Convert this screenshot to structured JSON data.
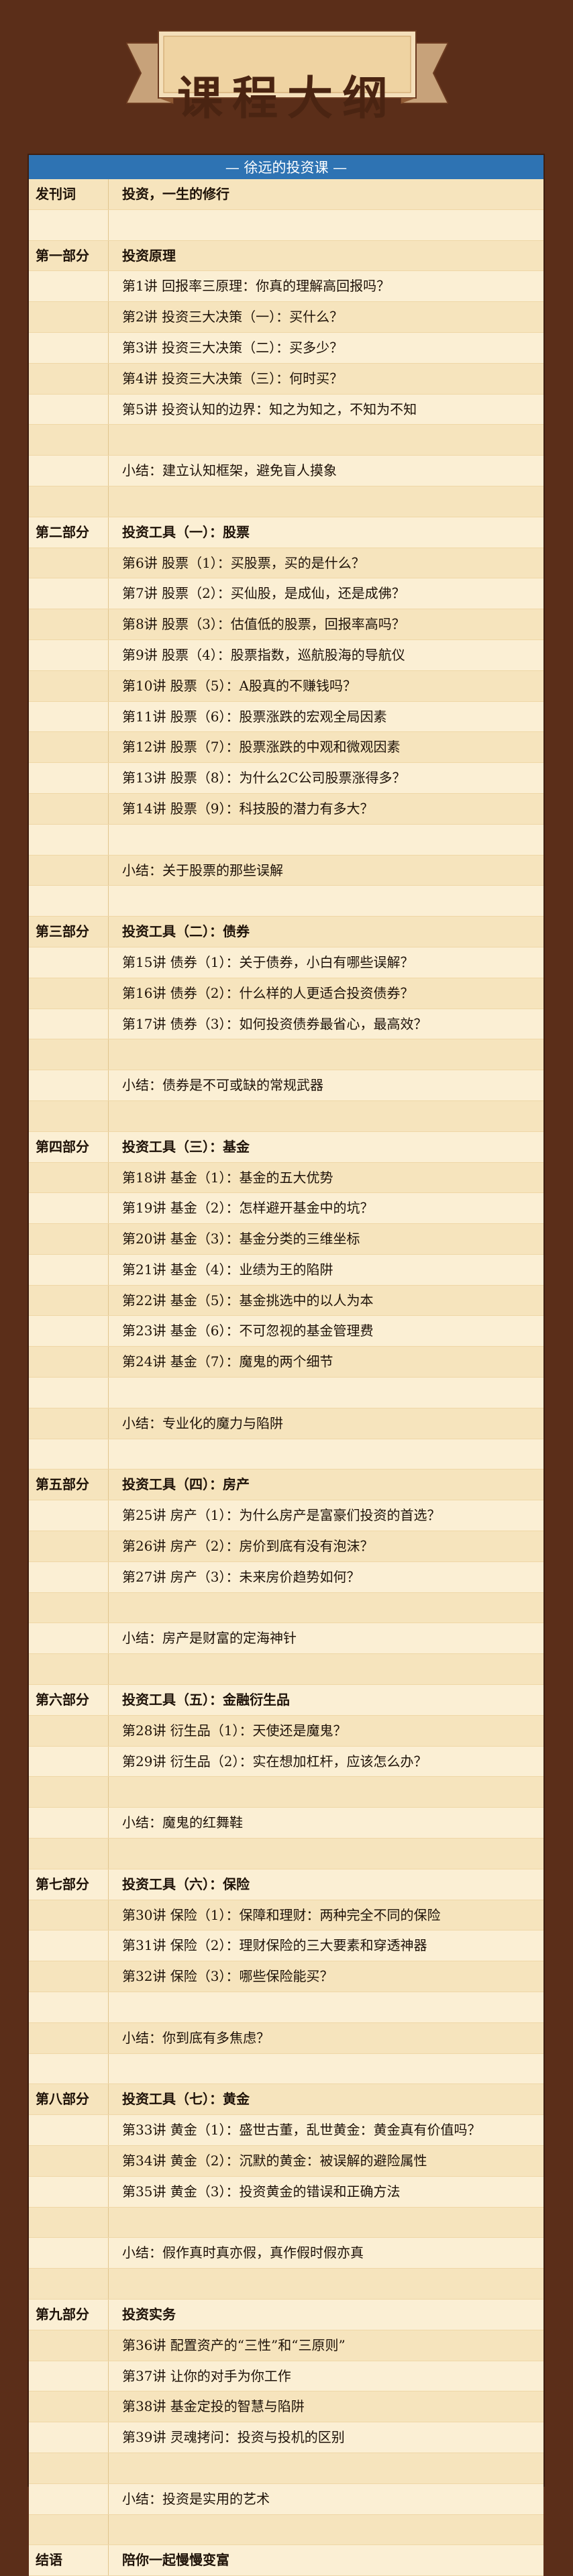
{
  "page_title": "课程大纲",
  "course_name": "— 徐远的投资课 —",
  "rows": [
    {
      "section": "发刊词",
      "text": "投资，一生的修行",
      "bold": true
    },
    {
      "section": "",
      "text": "",
      "bold": false
    },
    {
      "section": "第一部分",
      "text": "投资原理",
      "bold": true
    },
    {
      "section": "",
      "text": "第1讲  回报率三原理：你真的理解高回报吗？",
      "bold": false
    },
    {
      "section": "",
      "text": "第2讲  投资三大决策（一）：买什么？",
      "bold": false
    },
    {
      "section": "",
      "text": "第3讲  投资三大决策（二）：买多少？",
      "bold": false
    },
    {
      "section": "",
      "text": "第4讲  投资三大决策（三）：何时买？",
      "bold": false
    },
    {
      "section": "",
      "text": "第5讲  投资认知的边界：知之为知之，不知为不知",
      "bold": false
    },
    {
      "section": "",
      "text": "",
      "bold": false
    },
    {
      "section": "",
      "text": "小结：建立认知框架，避免盲人摸象",
      "bold": false
    },
    {
      "section": "",
      "text": "",
      "bold": false
    },
    {
      "section": "第二部分",
      "text": "投资工具（一）：股票",
      "bold": true
    },
    {
      "section": "",
      "text": "第6讲  股票（1）：买股票，买的是什么？",
      "bold": false
    },
    {
      "section": "",
      "text": "第7讲  股票（2）：买仙股，是成仙，还是成佛？",
      "bold": false
    },
    {
      "section": "",
      "text": "第8讲  股票（3）：估值低的股票，回报率高吗？",
      "bold": false
    },
    {
      "section": "",
      "text": "第9讲  股票（4）：股票指数，巡航股海的导航仪",
      "bold": false
    },
    {
      "section": "",
      "text": "第10讲 股票（5）：A股真的不赚钱吗？",
      "bold": false
    },
    {
      "section": "",
      "text": "第11讲 股票（6）：股票涨跌的宏观全局因素",
      "bold": false
    },
    {
      "section": "",
      "text": "第12讲 股票（7）：股票涨跌的中观和微观因素",
      "bold": false
    },
    {
      "section": "",
      "text": "第13讲 股票（8）：为什么2C公司股票涨得多？",
      "bold": false
    },
    {
      "section": "",
      "text": "第14讲 股票（9）：科技股的潜力有多大？",
      "bold": false
    },
    {
      "section": "",
      "text": "",
      "bold": false
    },
    {
      "section": "",
      "text": "小结：关于股票的那些误解",
      "bold": false
    },
    {
      "section": "",
      "text": "",
      "bold": false
    },
    {
      "section": "第三部分",
      "text": "投资工具（二）：债券",
      "bold": true
    },
    {
      "section": "",
      "text": "第15讲 债券（1）：关于债券，小白有哪些误解？",
      "bold": false
    },
    {
      "section": "",
      "text": "第16讲 债券（2）：什么样的人更适合投资债券？",
      "bold": false
    },
    {
      "section": "",
      "text": "第17讲 债券（3）：如何投资债券最省心，最高效？",
      "bold": false
    },
    {
      "section": "",
      "text": "",
      "bold": false
    },
    {
      "section": "",
      "text": "小结：债券是不可或缺的常规武器",
      "bold": false
    },
    {
      "section": "",
      "text": "",
      "bold": false
    },
    {
      "section": "第四部分",
      "text": "投资工具（三）：基金",
      "bold": true
    },
    {
      "section": "",
      "text": "第18讲 基金（1）：基金的五大优势",
      "bold": false
    },
    {
      "section": "",
      "text": "第19讲 基金（2）：怎样避开基金中的坑？",
      "bold": false
    },
    {
      "section": "",
      "text": "第20讲 基金（3）：基金分类的三维坐标",
      "bold": false
    },
    {
      "section": "",
      "text": "第21讲 基金（4）：业绩为王的陷阱",
      "bold": false
    },
    {
      "section": "",
      "text": "第22讲 基金（5）：基金挑选中的以人为本",
      "bold": false
    },
    {
      "section": "",
      "text": "第23讲 基金（6）：不可忽视的基金管理费",
      "bold": false
    },
    {
      "section": "",
      "text": "第24讲 基金（7）：魔鬼的两个细节",
      "bold": false
    },
    {
      "section": "",
      "text": "",
      "bold": false
    },
    {
      "section": "",
      "text": "小结：专业化的魔力与陷阱",
      "bold": false
    },
    {
      "section": "",
      "text": "",
      "bold": false
    },
    {
      "section": "第五部分",
      "text": "投资工具（四）：房产",
      "bold": true
    },
    {
      "section": "",
      "text": "第25讲 房产（1）：为什么房产是富豪们投资的首选？",
      "bold": false
    },
    {
      "section": "",
      "text": "第26讲 房产（2）：房价到底有没有泡沫？",
      "bold": false
    },
    {
      "section": "",
      "text": "第27讲 房产（3）：未来房价趋势如何？",
      "bold": false
    },
    {
      "section": "",
      "text": "",
      "bold": false
    },
    {
      "section": "",
      "text": "小结：房产是财富的定海神针",
      "bold": false
    },
    {
      "section": "",
      "text": "",
      "bold": false
    },
    {
      "section": "第六部分",
      "text": "投资工具（五）：金融衍生品",
      "bold": true
    },
    {
      "section": "",
      "text": "第28讲 衍生品（1）：天使还是魔鬼？",
      "bold": false
    },
    {
      "section": "",
      "text": "第29讲 衍生品（2）：实在想加杠杆，应该怎么办？",
      "bold": false
    },
    {
      "section": "",
      "text": "",
      "bold": false
    },
    {
      "section": "",
      "text": "小结：魔鬼的红舞鞋",
      "bold": false
    },
    {
      "section": "",
      "text": "",
      "bold": false
    },
    {
      "section": "第七部分",
      "text": "投资工具（六）：保险",
      "bold": true
    },
    {
      "section": "",
      "text": "第30讲 保险（1）：保障和理财：两种完全不同的保险",
      "bold": false
    },
    {
      "section": "",
      "text": "第31讲 保险（2）：理财保险的三大要素和穿透神器",
      "bold": false
    },
    {
      "section": "",
      "text": "第32讲 保险（3）：哪些保险能买？",
      "bold": false
    },
    {
      "section": "",
      "text": "",
      "bold": false
    },
    {
      "section": "",
      "text": "小结：你到底有多焦虑？",
      "bold": false
    },
    {
      "section": "",
      "text": "",
      "bold": false
    },
    {
      "section": "第八部分",
      "text": "投资工具（七）：黄金",
      "bold": true
    },
    {
      "section": "",
      "text": "第33讲 黄金（1）：盛世古董，乱世黄金：黄金真有价值吗？",
      "bold": false
    },
    {
      "section": "",
      "text": "第34讲 黄金（2）：沉默的黄金：被误解的避险属性",
      "bold": false
    },
    {
      "section": "",
      "text": "第35讲 黄金（3）：投资黄金的错误和正确方法",
      "bold": false
    },
    {
      "section": "",
      "text": "",
      "bold": false
    },
    {
      "section": "",
      "text": "小结：假作真时真亦假，真作假时假亦真",
      "bold": false
    },
    {
      "section": "",
      "text": "",
      "bold": false
    },
    {
      "section": "第九部分",
      "text": "投资实务",
      "bold": true
    },
    {
      "section": "",
      "text": "第36讲 配置资产的“三性”和“三原则”",
      "bold": false
    },
    {
      "section": "",
      "text": "第37讲 让你的对手为你工作",
      "bold": false
    },
    {
      "section": "",
      "text": "第38讲 基金定投的智慧与陷阱",
      "bold": false
    },
    {
      "section": "",
      "text": "第39讲 灵魂拷问：投资与投机的区别",
      "bold": false
    },
    {
      "section": "",
      "text": "",
      "bold": false
    },
    {
      "section": "",
      "text": "小结：投资是实用的艺术",
      "bold": false
    },
    {
      "section": "",
      "text": "",
      "bold": false
    },
    {
      "section": "结语",
      "text": "陪你一起慢慢变富",
      "bold": true
    }
  ]
}
